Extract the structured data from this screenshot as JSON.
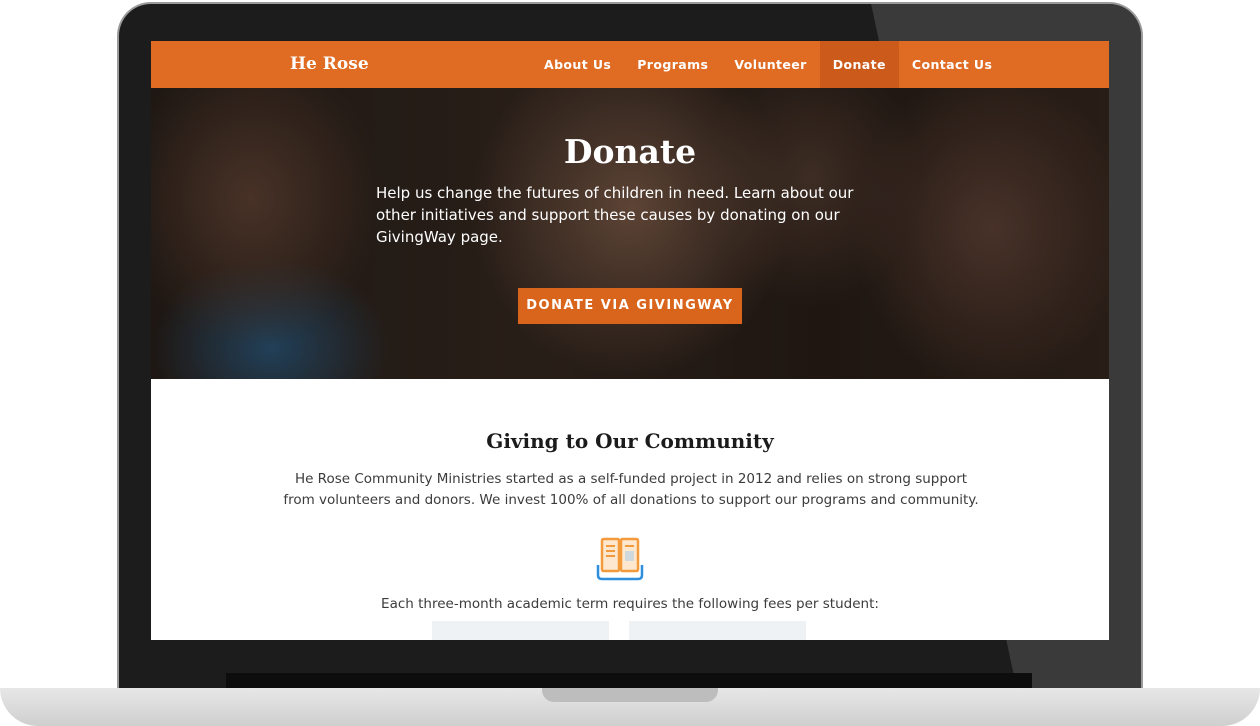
{
  "nav": {
    "brand": "He Rose",
    "items": [
      "About Us",
      "Programs",
      "Volunteer",
      "Donate",
      "Contact Us"
    ],
    "active": "Donate"
  },
  "hero": {
    "title": "Donate",
    "text": "Help us change the futures of children in need. Learn about our other initiatives and support these causes by donating on our GivingWay page.",
    "button": "DONATE VIA GIVINGWAY"
  },
  "community": {
    "title": "Giving to Our Community",
    "text": "He Rose Community Ministries started as a self-funded project in 2012 and relies on strong support from volunteers and donors. We invest 100% of all donations to support our programs and community.",
    "icon": "book-icon",
    "fees_text": "Each three-month academic term requires the following fees per student:"
  },
  "colors": {
    "accent": "#e06c24",
    "button": "#d9651d",
    "icon_orange": "#f39a3d",
    "icon_blue": "#2f8fdc"
  }
}
